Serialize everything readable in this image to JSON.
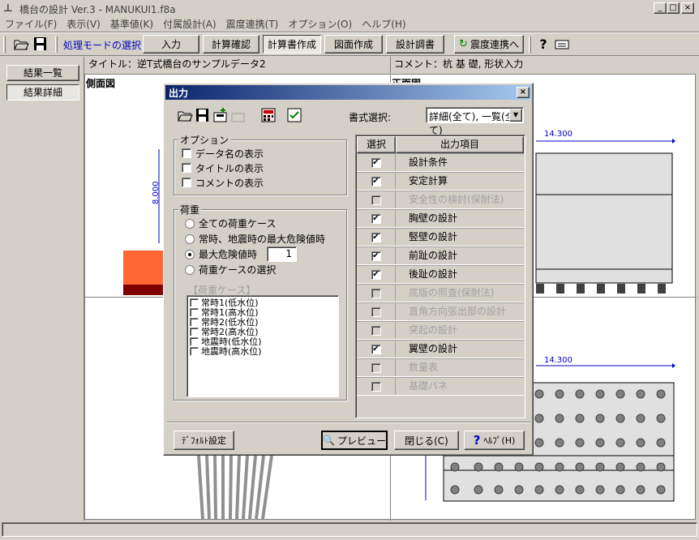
{
  "window": {
    "title": "橋台の設計 Ver.3 - MANUKUI1.f8a",
    "min": "_",
    "max": "□",
    "close": "×"
  },
  "menu": [
    "ファイル(F)",
    "表示(V)",
    "基準値(K)",
    "付属設計(A)",
    "震度連携(T)",
    "オプション(O)",
    "ヘルプ(H)"
  ],
  "toolbar": {
    "mode_label": "処理モードの選択",
    "modes": [
      "入力",
      "計算確認",
      "計算書作成",
      "図面作成",
      "設計調書"
    ],
    "seismic": "震度連携へ",
    "help_icon": "?"
  },
  "sidebar": {
    "items": [
      "結果一覧",
      "結果詳細"
    ]
  },
  "header": {
    "title": "タイトル：逆T式橋台のサンプルデータ2",
    "comment": "コメント：杭 基 礎, 形状入力"
  },
  "views": {
    "side": "側面図",
    "front": "正面図",
    "dim_vertical": "8.000",
    "dim_top": "14.300",
    "dim_bottom": "14.300"
  },
  "dialog": {
    "title": "出力",
    "format_label": "書式選択:",
    "format_value": "詳細(全て), 一覧(全て)",
    "options": {
      "legend": "オプション",
      "items": [
        {
          "label": "データ名の表示",
          "checked": false
        },
        {
          "label": "タイトルの表示",
          "checked": false
        },
        {
          "label": "コメントの表示",
          "checked": false
        }
      ]
    },
    "load": {
      "legend": "荷重",
      "radios": [
        "全ての荷重ケース",
        "常時、地震時の最大危険値時",
        "最大危険値時",
        "荷重ケースの選択"
      ],
      "selected": 2,
      "max_value": "1",
      "case_label": "【荷重ケース】",
      "cases": [
        "常時1(低水位)",
        "常時1(高水位)",
        "常時2(低水位)",
        "常時2(高水位)",
        "地震時(低水位)",
        "地震時(高水位)"
      ]
    },
    "table": {
      "col_select": "選択",
      "col_item": "出力項目",
      "rows": [
        {
          "label": "設計条件",
          "checked": true,
          "enabled": true
        },
        {
          "label": "安定計算",
          "checked": true,
          "enabled": true
        },
        {
          "label": "安全性の検討(保耐法)",
          "checked": false,
          "enabled": false
        },
        {
          "label": "胸壁の設計",
          "checked": true,
          "enabled": true
        },
        {
          "label": "竪壁の設計",
          "checked": true,
          "enabled": true
        },
        {
          "label": "前趾の設計",
          "checked": true,
          "enabled": true
        },
        {
          "label": "後趾の設計",
          "checked": true,
          "enabled": true
        },
        {
          "label": "底版の照査(保耐法)",
          "checked": false,
          "enabled": false
        },
        {
          "label": "直角方向張出部の設計",
          "checked": false,
          "enabled": false
        },
        {
          "label": "突起の設計",
          "checked": false,
          "enabled": false
        },
        {
          "label": "翼壁の設計",
          "checked": true,
          "enabled": true
        },
        {
          "label": "数量表",
          "checked": false,
          "enabled": false
        },
        {
          "label": "基礎バネ",
          "checked": false,
          "enabled": false
        }
      ]
    },
    "buttons": {
      "default": "ﾃﾞﾌｫﾙﾄ設定",
      "preview": "プレビュー",
      "close": "閉じる(C)",
      "help": "ﾍﾙﾌﾟ(H)"
    }
  },
  "colors": {
    "dialog_title_from": "#0a246a",
    "dialog_title_to": "#a6caf0",
    "orange": "#ff6633",
    "darkred": "#800000",
    "blue": "#0000c0"
  }
}
